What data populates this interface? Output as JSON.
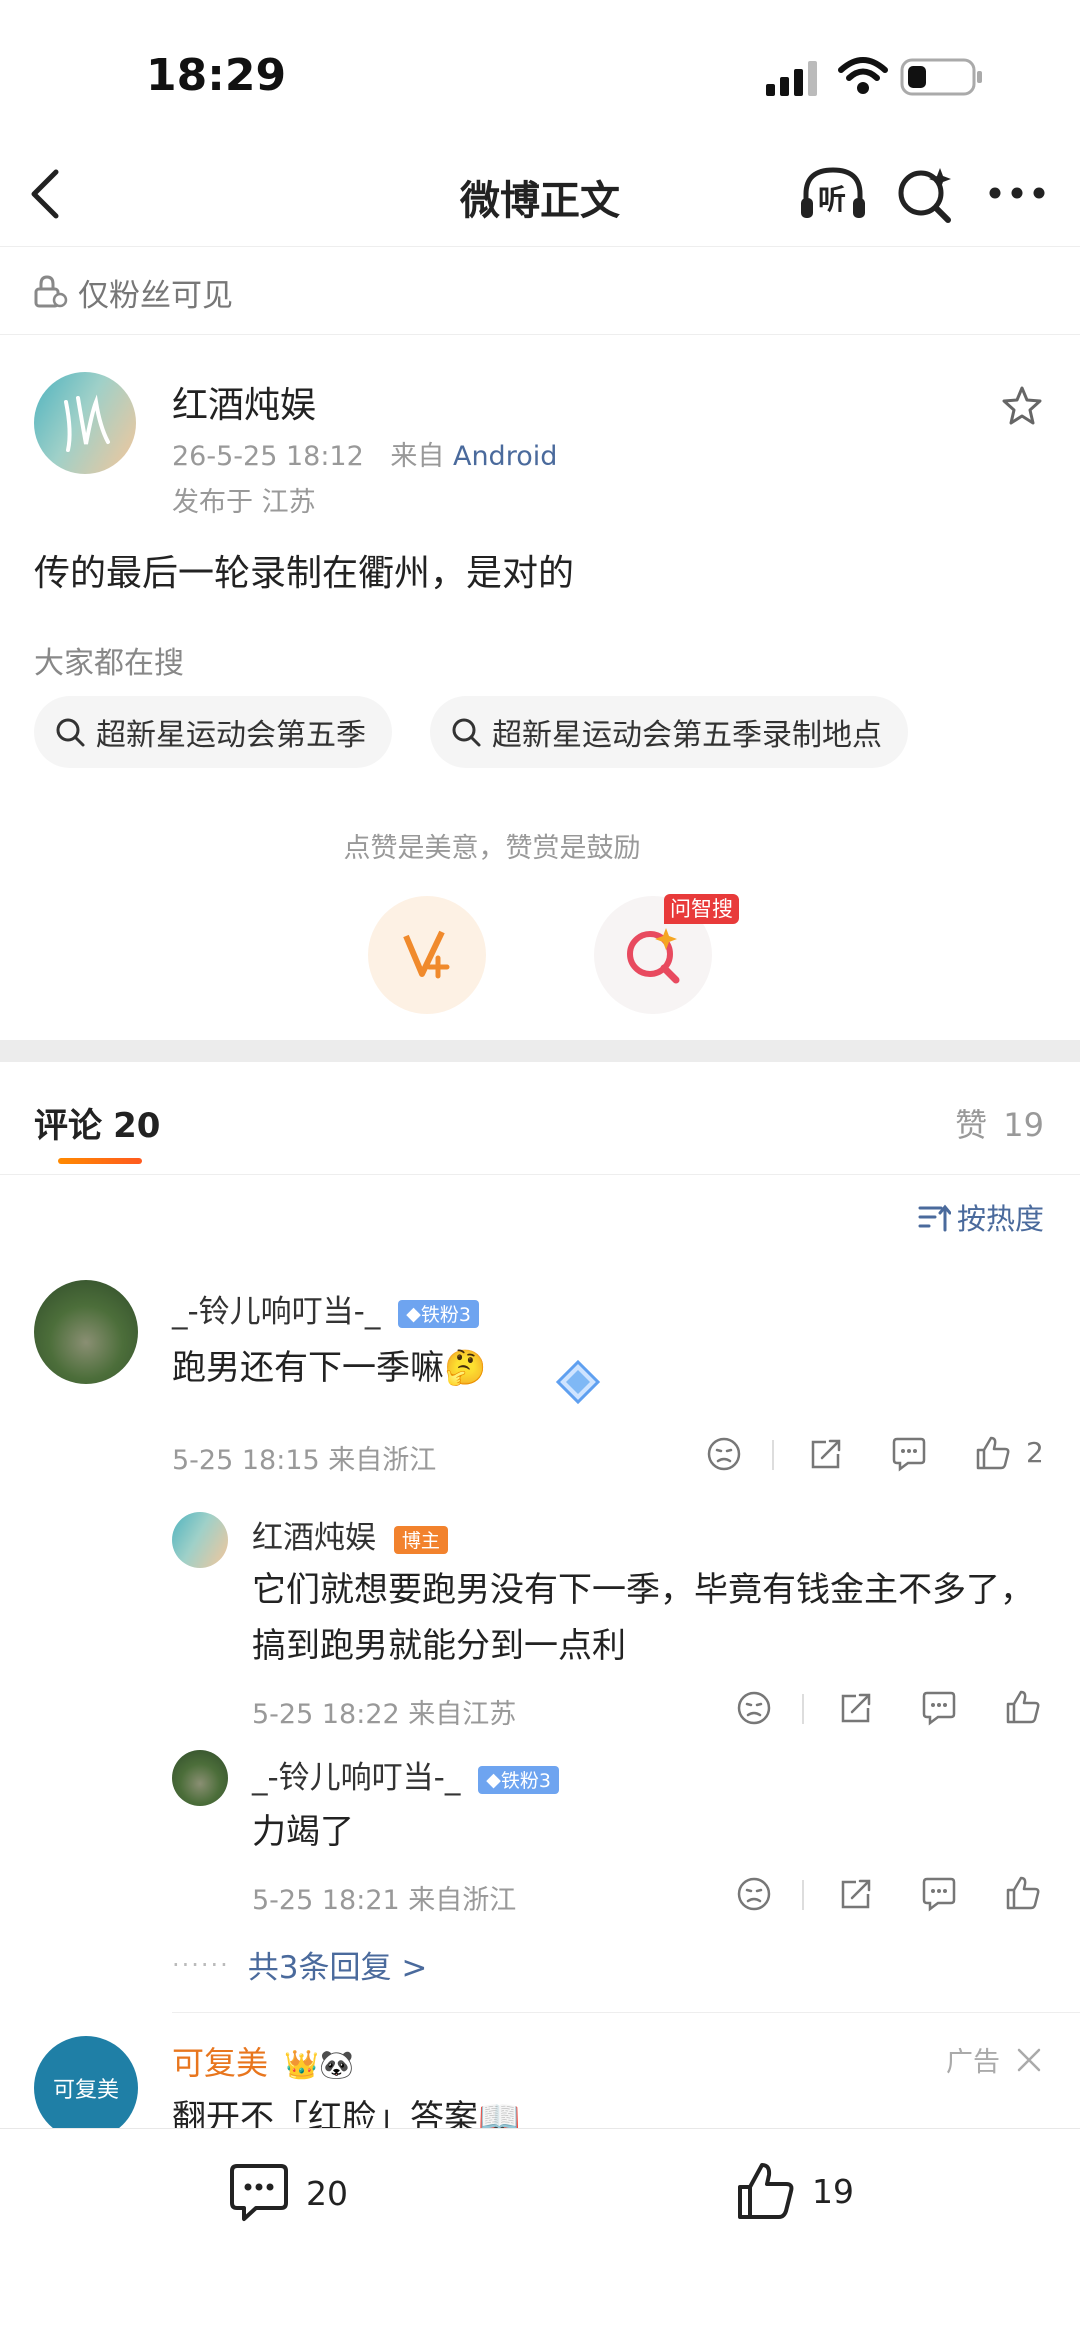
{
  "status_bar": {
    "time": "18:29"
  },
  "nav": {
    "title": "微博正文",
    "listen_label": "听"
  },
  "visibility": {
    "label": "仅粉丝可见"
  },
  "post": {
    "author": "红酒炖娱",
    "meta_time": "26-5-25 18:12",
    "meta_from_prefix": "来自",
    "meta_from_source": "Android",
    "location": "发布于 江苏",
    "text": "传的最后一轮录制在衢州，是对的"
  },
  "trending": {
    "heading": "大家都在搜",
    "chips": [
      "超新星运动会第五季",
      "超新星运动会第五季录制地点"
    ]
  },
  "reward": {
    "hint": "点赞是美意，赞赏是鼓励",
    "ask_badge": "问智搜"
  },
  "tabs": {
    "comments_label": "评论",
    "comments_count": "20",
    "likes_label": "赞",
    "likes_count": "19"
  },
  "sort": {
    "label": "按热度"
  },
  "comments": [
    {
      "author": "_-铃儿响叮当-_",
      "badge": "铁粉3",
      "text": "跑男还有下一季嘛🤔",
      "meta": "5-25 18:15 来自浙江",
      "likes": "2",
      "replies": [
        {
          "author": "红酒炖娱",
          "badge": "博主",
          "text": "它们就想要跑男没有下一季，毕竟有钱金主不多了，搞到跑男就能分到一点利",
          "meta": "5-25 18:22 来自江苏"
        },
        {
          "author": "_-铃儿响叮当-_",
          "badge": "铁粉3",
          "text": "力竭了",
          "meta": "5-25 18:21 来自浙江"
        }
      ],
      "more_replies": "共3条回复 >"
    }
  ],
  "ad": {
    "author": "可复美",
    "avatar_text": "可复美",
    "label": "广告",
    "text": "翻开不「红脸」答案📖"
  },
  "bottom_bar": {
    "comments": "20",
    "likes": "19"
  },
  "colors": {
    "accent": "#ff8200",
    "link": "#4a6a9c",
    "badge_fan": "#6ea4f0",
    "badge_host": "#f2822d",
    "ad_name": "#e8761e"
  }
}
